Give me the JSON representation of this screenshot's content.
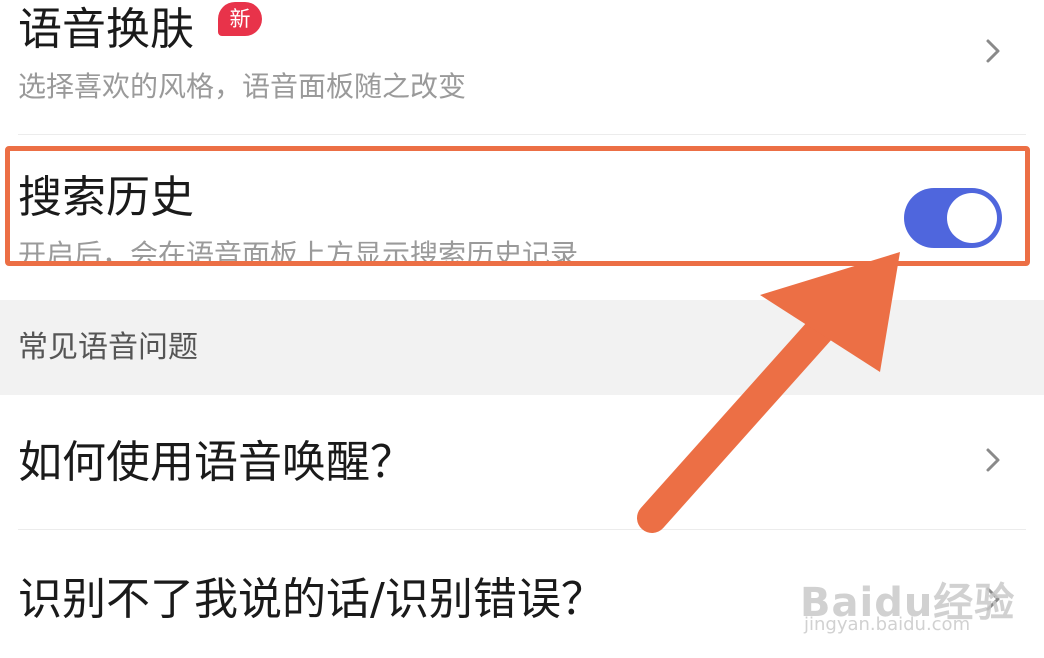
{
  "voice_skin": {
    "title": "语音换肤",
    "badge": "新",
    "subtitle": "选择喜欢的风格，语音面板随之改变"
  },
  "search_history": {
    "title": "搜索历史",
    "subtitle": "开启后，会在语音面板上方显示搜索历史记录",
    "toggle_on": true
  },
  "section": {
    "header": "常见语音问题"
  },
  "faq": [
    {
      "title": "如何使用语音唤醒？"
    },
    {
      "title": "识别不了我说的话/识别错误？"
    }
  ],
  "watermark": {
    "brand": "Baidu经验",
    "url": "jingyan.baidu.com"
  },
  "colors": {
    "accent": "#4f66dd",
    "badge": "#e8334a",
    "annotation": "#ec6f45"
  },
  "icons": {
    "chevron": "chevron-right-icon",
    "toggle": "toggle-switch"
  }
}
